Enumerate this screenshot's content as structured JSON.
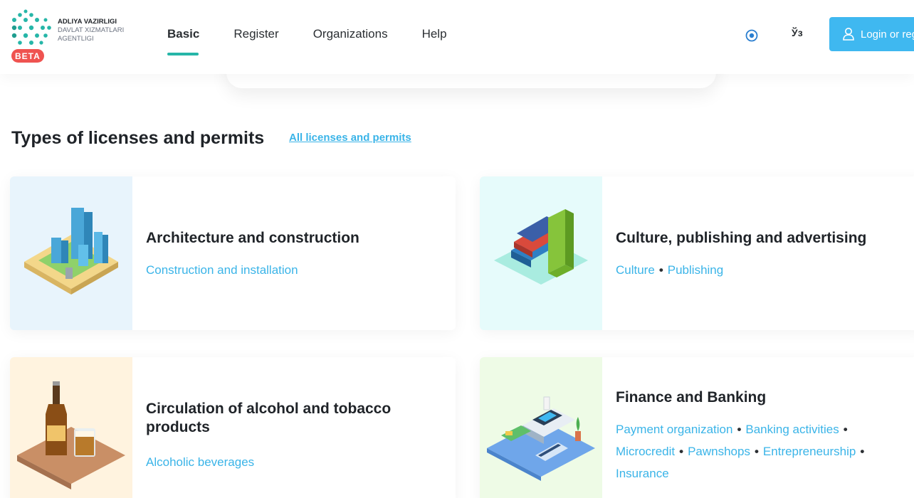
{
  "brand": {
    "line1": "ADLIYA VAZIRLIGI",
    "line2": "DAVLAT XIZMATLARI",
    "line3": "AGENTLIGI",
    "badge": "BETA"
  },
  "nav": [
    {
      "label": "Basic",
      "active": true
    },
    {
      "label": "Register"
    },
    {
      "label": "Organizations"
    },
    {
      "label": "Help"
    }
  ],
  "header_actions": {
    "accessibility_icon": "eye-icon",
    "language_label": "Ўз",
    "login_label": "Login or reg",
    "login_icon": "user-icon"
  },
  "section": {
    "title": "Types of licenses and permits",
    "all_link": "All licenses and permits"
  },
  "cards": [
    {
      "title": "Architecture and construction",
      "links": [
        "Construction and installation"
      ],
      "illustration": "city-buildings-icon",
      "bg": "#e8f4fc"
    },
    {
      "title": "Culture, publishing and advertising",
      "links": [
        "Culture",
        "Publishing"
      ],
      "illustration": "books-icon",
      "bg": "#e6fbfb"
    },
    {
      "title_line1": "Circulation of alcohol and tobacco",
      "title_line2": "products",
      "links": [
        "Alcoholic beverages"
      ],
      "illustration": "bottle-glass-icon",
      "bg": "#fff3df"
    },
    {
      "title": "Finance and Banking",
      "links_line1": [
        "Payment organization",
        "Banking activities"
      ],
      "links_line2": [
        "Microcredit",
        "Pawnshops",
        "Entrepreneurship"
      ],
      "links_line3": [
        "Insurance"
      ],
      "illustration": "payment-terminal-icon",
      "bg": "#eefbe6"
    }
  ],
  "colors": {
    "accent": "#3ab4e8",
    "active_tab": "#26b6a8",
    "login_button": "#3fb8f0",
    "beta_badge": "#ef5350",
    "logo_green": "#26b6a8"
  }
}
